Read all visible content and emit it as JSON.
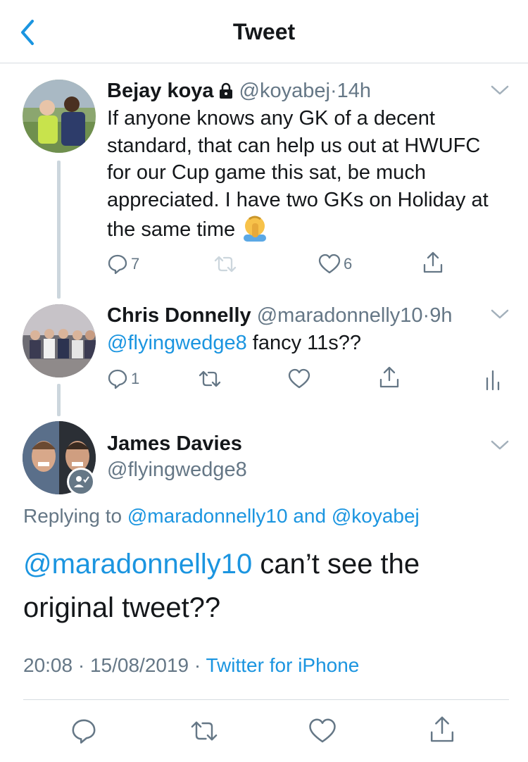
{
  "nav": {
    "title": "Tweet"
  },
  "tweet1": {
    "name": "Bejay koya",
    "handle": "@koyabej",
    "separator": "·",
    "time": "14h",
    "text": "If anyone knows any GK of a decent standard, that can help us out at HWUFC for our Cup game this sat, be much appreciated. I have two GKs on Holiday at the same time",
    "emoji": "🤦",
    "reply_count": "7",
    "like_count": "6"
  },
  "tweet2": {
    "name": "Chris Donnelly",
    "handle": "@maradonnelly10",
    "separator": "·",
    "time": "9h",
    "mention": "@flyingwedge8",
    "text": " fancy 11s??",
    "reply_count": "1"
  },
  "main": {
    "name": "James Davies",
    "handle": "@flyingwedge8",
    "replying_prefix": "Replying to ",
    "replying_user1": "@maradonnelly10",
    "replying_and": " and ",
    "replying_user2": "@koyabej",
    "mention": "@maradonnelly10",
    "text": " can’t see the original tweet??",
    "time": "20:08",
    "separator": " · ",
    "date": "15/08/2019",
    "separator2": " · ",
    "source": "Twitter for iPhone"
  },
  "colors": {
    "accent": "#1b95e0",
    "secondary_text": "#657786",
    "primary_text": "#14171a",
    "divider": "#d6dce0"
  },
  "icons": [
    "back-chevron-icon",
    "lock-icon",
    "chevron-down-icon",
    "reply-icon",
    "retweet-icon",
    "like-icon",
    "share-icon",
    "analytics-icon",
    "verified-person-icon",
    "facepalm-emoji"
  ]
}
